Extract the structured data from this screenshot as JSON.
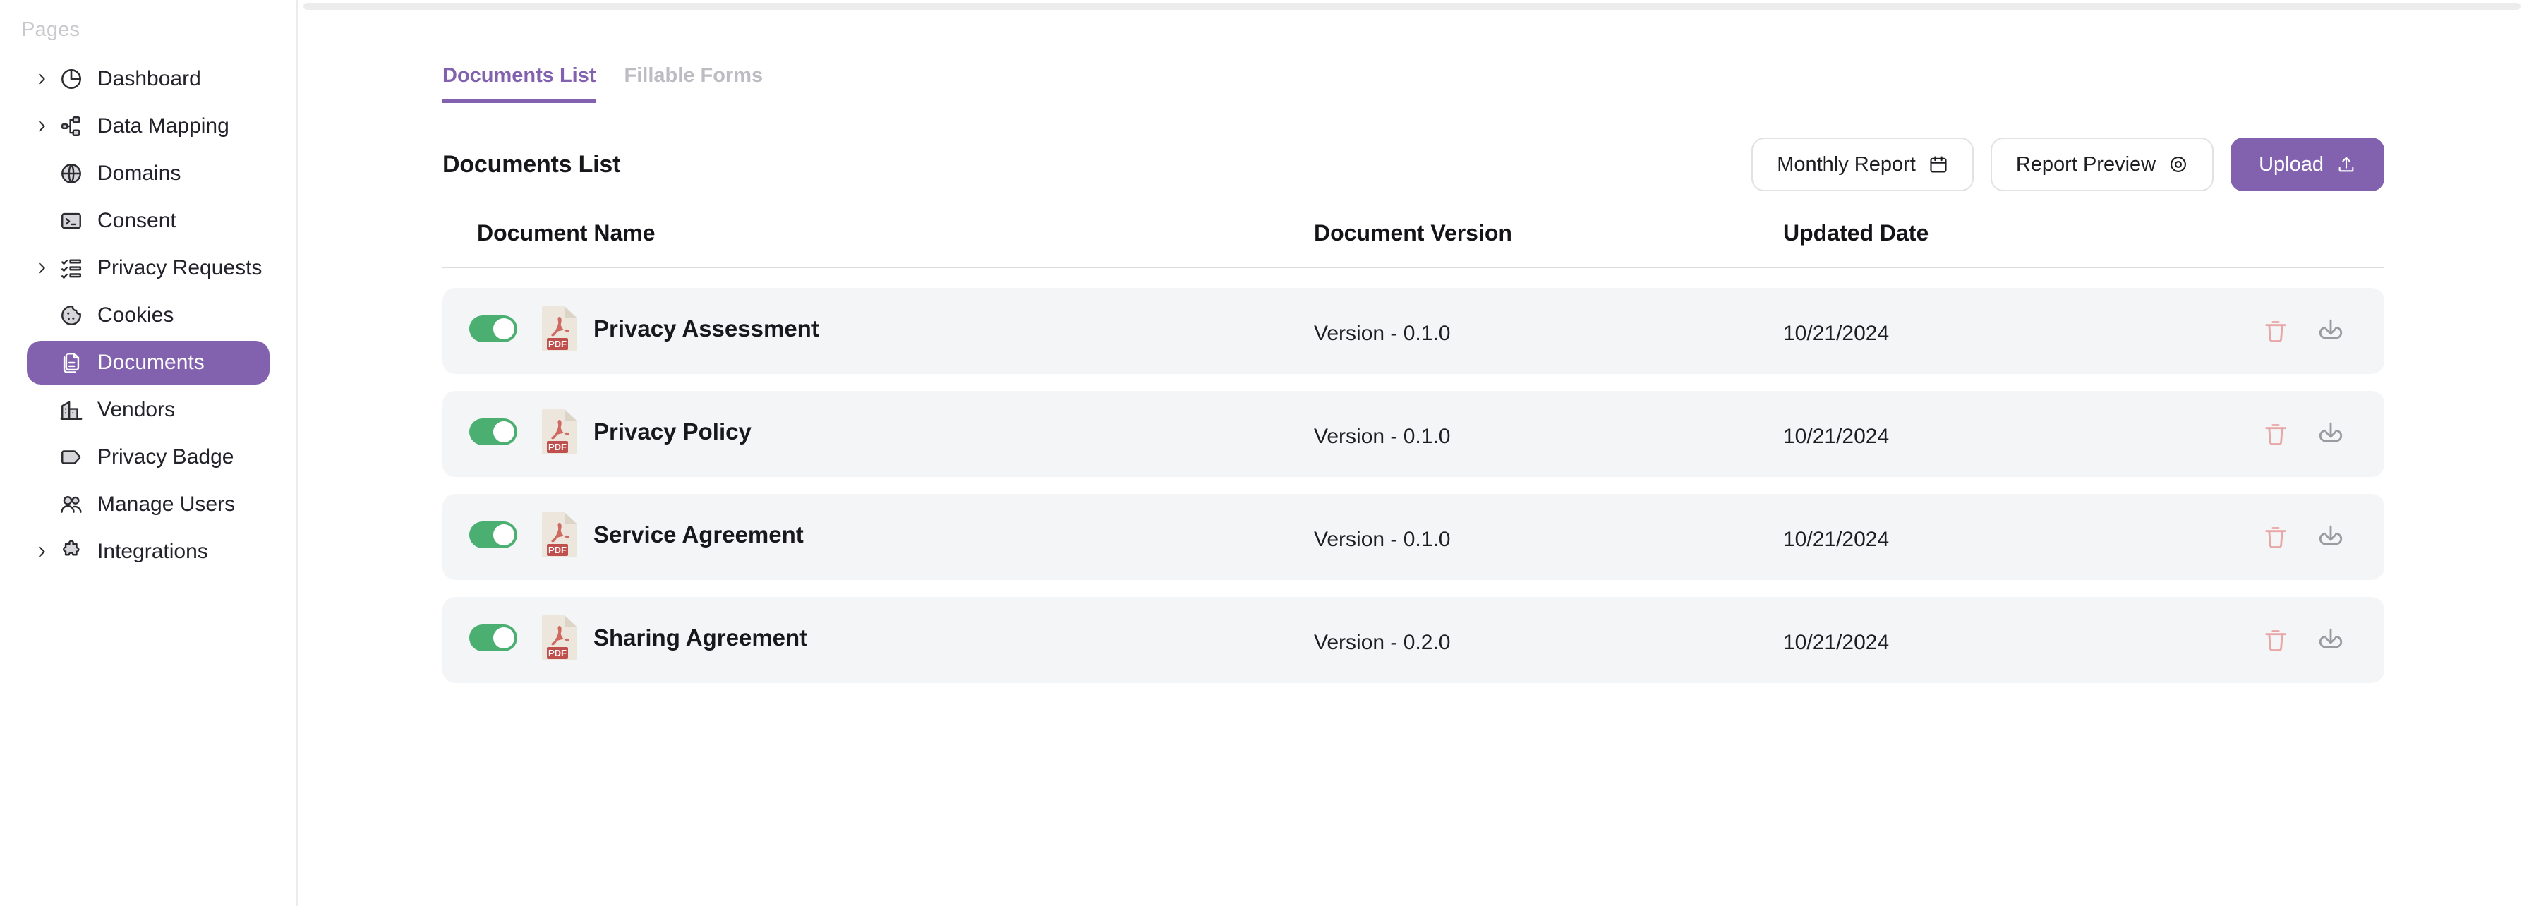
{
  "sidebar": {
    "section_label": "Pages",
    "items": [
      {
        "label": "Dashboard",
        "icon": "pie-chart-icon",
        "expandable": true,
        "active": false
      },
      {
        "label": "Data Mapping",
        "icon": "sitemap-icon",
        "expandable": true,
        "active": false
      },
      {
        "label": "Domains",
        "icon": "globe-icon",
        "expandable": false,
        "active": false
      },
      {
        "label": "Consent",
        "icon": "terminal-icon",
        "expandable": false,
        "active": false
      },
      {
        "label": "Privacy Requests",
        "icon": "checklist-icon",
        "expandable": true,
        "active": false
      },
      {
        "label": "Cookies",
        "icon": "cookie-icon",
        "expandable": false,
        "active": false
      },
      {
        "label": "Documents",
        "icon": "documents-icon",
        "expandable": false,
        "active": true
      },
      {
        "label": "Vendors",
        "icon": "building-icon",
        "expandable": false,
        "active": false
      },
      {
        "label": "Privacy Badge",
        "icon": "tag-icon",
        "expandable": false,
        "active": false
      },
      {
        "label": "Manage Users",
        "icon": "users-icon",
        "expandable": false,
        "active": false
      },
      {
        "label": "Integrations",
        "icon": "puzzle-piece-icon",
        "expandable": true,
        "active": false
      }
    ]
  },
  "tabs": [
    {
      "label": "Documents List",
      "active": true
    },
    {
      "label": "Fillable Forms",
      "active": false
    }
  ],
  "main": {
    "page_title": "Documents List",
    "buttons": [
      {
        "label": "Monthly Report",
        "icon": "calendar-icon",
        "variant": "secondary"
      },
      {
        "label": "Report Preview",
        "icon": "eye-icon",
        "variant": "secondary"
      },
      {
        "label": "Upload",
        "icon": "upload-icon",
        "variant": "primary"
      }
    ]
  },
  "table": {
    "columns": [
      "Document Name",
      "Document Version",
      "Updated Date"
    ],
    "rows": [
      {
        "enabled": true,
        "file_type": "PDF",
        "name": "Privacy Assessment",
        "version": "Version - 0.1.0",
        "updated": "10/21/2024"
      },
      {
        "enabled": true,
        "file_type": "PDF",
        "name": "Privacy Policy",
        "version": "Version - 0.1.0",
        "updated": "10/21/2024"
      },
      {
        "enabled": true,
        "file_type": "PDF",
        "name": "Service Agreement",
        "version": "Version - 0.1.0",
        "updated": "10/21/2024"
      },
      {
        "enabled": true,
        "file_type": "PDF",
        "name": "Sharing Agreement",
        "version": "Version - 0.2.0",
        "updated": "10/21/2024"
      }
    ],
    "row_actions": [
      {
        "name": "delete",
        "icon": "trash-icon"
      },
      {
        "name": "download",
        "icon": "download-icon"
      }
    ]
  },
  "colors": {
    "accent_purple": "#8262ae",
    "toggle_green": "#4caf72",
    "row_bg": "#f4f5f7",
    "delete_red": "#e8a6a6",
    "pdf_red": "#c0504d"
  }
}
